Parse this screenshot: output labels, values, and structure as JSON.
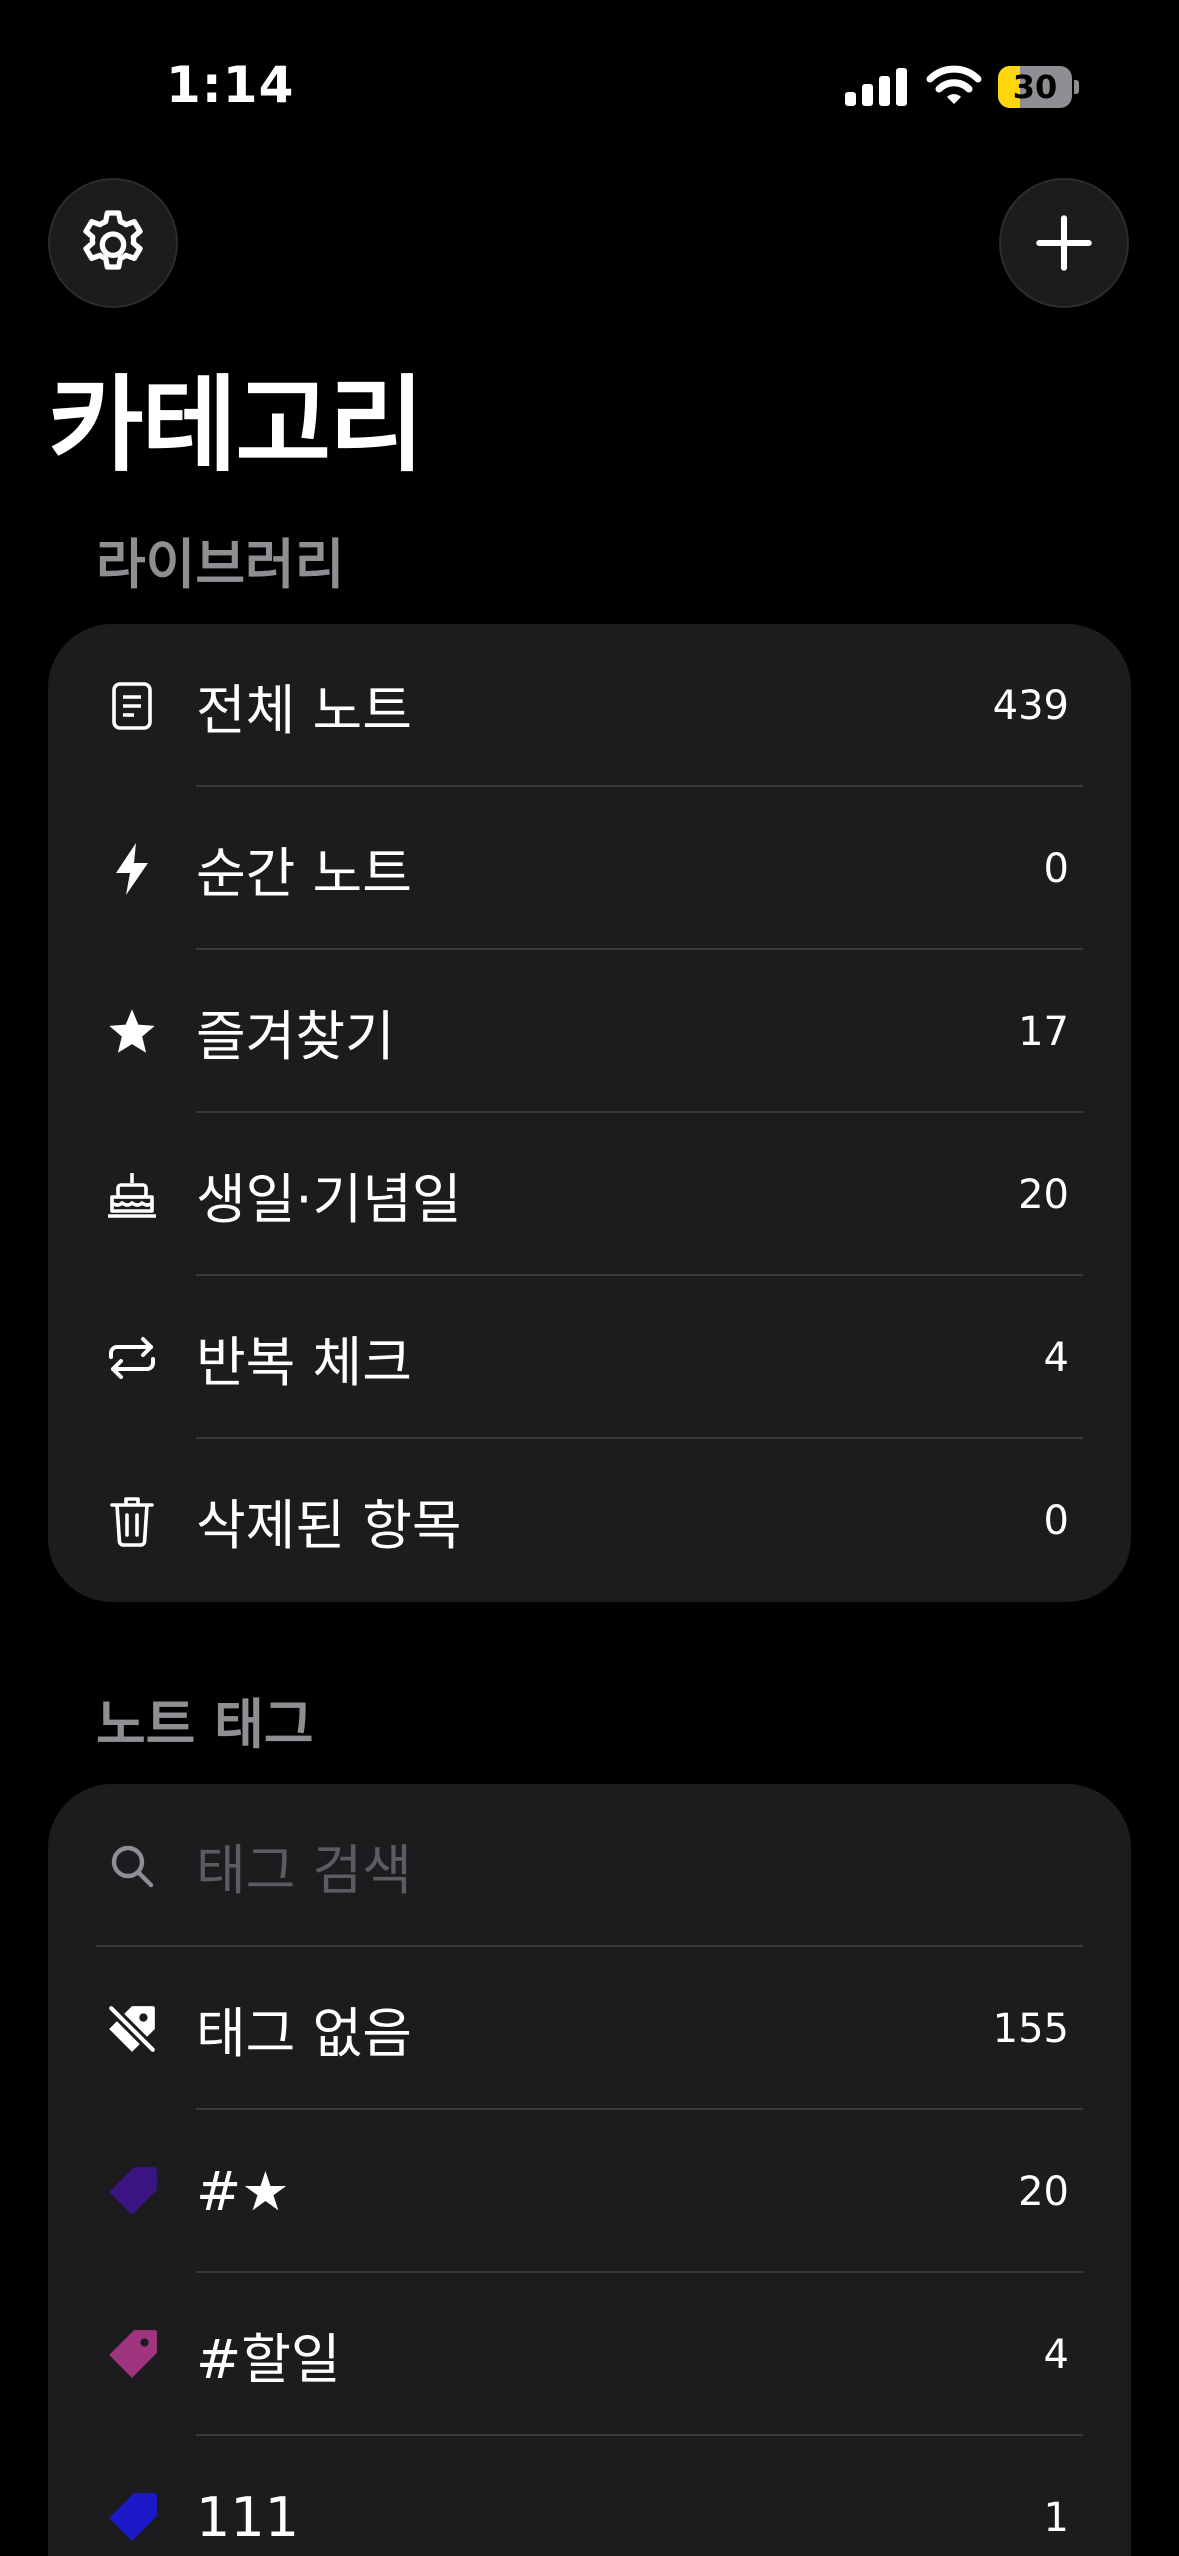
{
  "status_bar": {
    "time": "1:14",
    "battery": "30",
    "battery_level": 0.3
  },
  "header": {
    "title": "카테고리"
  },
  "library": {
    "label": "라이브러리",
    "items": [
      {
        "label": "전체 노트",
        "count": "439",
        "icon": "note-icon"
      },
      {
        "label": "순간 노트",
        "count": "0",
        "icon": "bolt-icon"
      },
      {
        "label": "즐겨찾기",
        "count": "17",
        "icon": "star-icon"
      },
      {
        "label": "생일·기념일",
        "count": "20",
        "icon": "cake-icon"
      },
      {
        "label": "반복 체크",
        "count": "4",
        "icon": "repeat-icon"
      },
      {
        "label": "삭제된 항목",
        "count": "0",
        "icon": "trash-icon"
      }
    ]
  },
  "tags": {
    "label": "노트 태그",
    "search_placeholder": "태그 검색",
    "items": [
      {
        "label": "태그 없음",
        "count": "155",
        "icon": "no-tag-icon"
      },
      {
        "label": "#★",
        "count": "20",
        "icon": "tag-icon",
        "color": "#3a1480"
      },
      {
        "label": "#할일",
        "count": "4",
        "icon": "tag-icon",
        "color": "#a0357f"
      },
      {
        "label": "111",
        "count": "1",
        "icon": "tag-icon",
        "color": "#1c19c8"
      }
    ]
  }
}
